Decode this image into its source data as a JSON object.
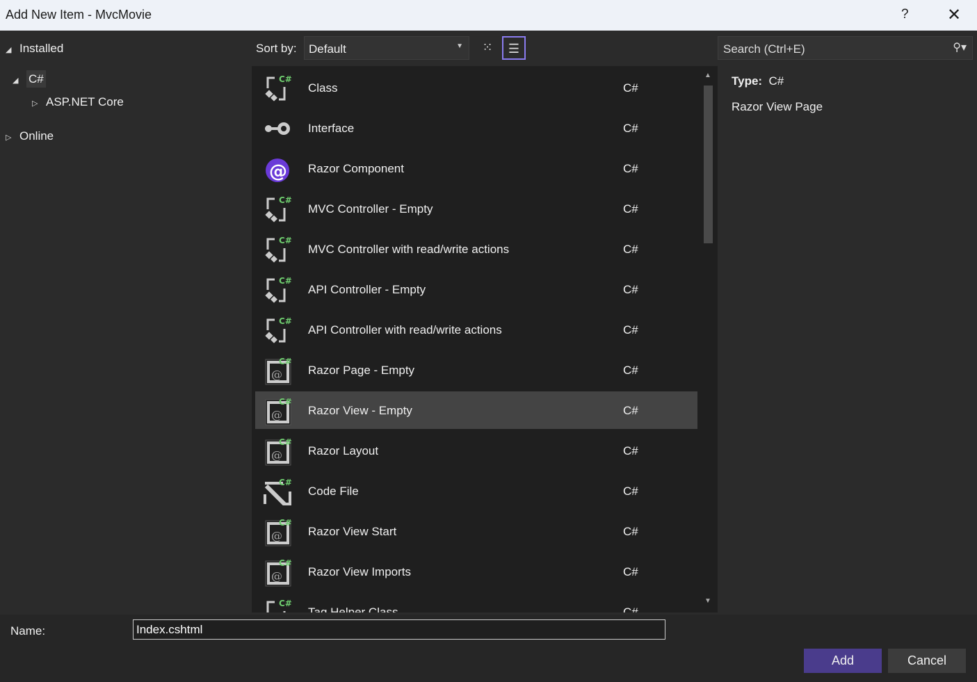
{
  "window": {
    "title": "Add New Item - MvcMovie",
    "help": "?",
    "close": "✕"
  },
  "tree": {
    "installed": "Installed",
    "csharp": "C#",
    "aspnet": "ASP.NET Core",
    "online": "Online"
  },
  "toolbar": {
    "sort_label": "Sort by:",
    "sort_value": "Default",
    "view_grid_icon": "grid-view",
    "view_list_icon": "list-view",
    "active_view": "list"
  },
  "search": {
    "placeholder": "Search (Ctrl+E)"
  },
  "items": [
    {
      "name": "Class",
      "lang": "C#",
      "icon": "class"
    },
    {
      "name": "Interface",
      "lang": "C#",
      "icon": "interface"
    },
    {
      "name": "Razor Component",
      "lang": "C#",
      "icon": "blazor"
    },
    {
      "name": "MVC Controller - Empty",
      "lang": "C#",
      "icon": "class"
    },
    {
      "name": "MVC Controller with read/write actions",
      "lang": "C#",
      "icon": "class"
    },
    {
      "name": "API Controller - Empty",
      "lang": "C#",
      "icon": "class"
    },
    {
      "name": "API Controller with read/write actions",
      "lang": "C#",
      "icon": "class"
    },
    {
      "name": "Razor Page - Empty",
      "lang": "C#",
      "icon": "razor"
    },
    {
      "name": "Razor View - Empty",
      "lang": "C#",
      "icon": "razor",
      "selected": true
    },
    {
      "name": "Razor Layout",
      "lang": "C#",
      "icon": "razor"
    },
    {
      "name": "Code File",
      "lang": "C#",
      "icon": "code"
    },
    {
      "name": "Razor View Start",
      "lang": "C#",
      "icon": "razor"
    },
    {
      "name": "Razor View Imports",
      "lang": "C#",
      "icon": "razor"
    },
    {
      "name": "Tag Helper Class",
      "lang": "C#",
      "icon": "class"
    }
  ],
  "details": {
    "type_label": "Type:",
    "type_value": "C#",
    "description": "Razor View Page"
  },
  "footer": {
    "name_label": "Name:",
    "name_value": "Index.cshtml",
    "add": "Add",
    "cancel": "Cancel"
  },
  "colors": {
    "accent": "#4a3c8c",
    "focus": "#8a7cf0",
    "csharp_badge": "#6fce6f"
  }
}
